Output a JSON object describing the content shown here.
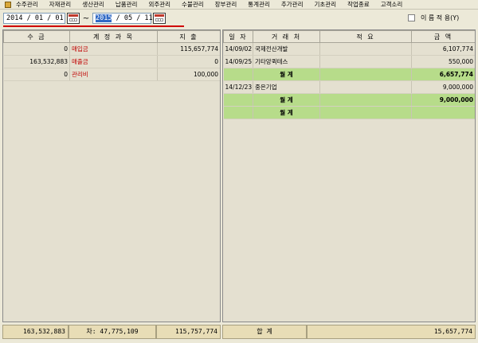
{
  "menu": [
    "수주관리",
    "자재관리",
    "생산관리",
    "납품관리",
    "외주관리",
    "수불관리",
    "장부관리",
    "통계관리",
    "추가관리",
    "기초관리",
    "작업종료",
    "고객소리"
  ],
  "date_range": {
    "start": "2014 / 01 / 01",
    "end_year": "2015",
    "end_rest": " / 05 / 11",
    "separator": "~"
  },
  "option": {
    "label": "이 름  적 용(Y)",
    "checked": false
  },
  "left_table": {
    "headers": [
      "수    금",
      "계 정 과 목",
      "지    출"
    ],
    "rows": [
      {
        "income": "0",
        "account": "매입금",
        "expense": "115,657,774"
      },
      {
        "income": "163,532,883",
        "account": "매출금",
        "expense": "0"
      },
      {
        "income": "0",
        "account": "관리비",
        "expense": "100,000"
      }
    ]
  },
  "right_table": {
    "headers": [
      "일 자",
      "거 래 처",
      "적      요",
      "금    액"
    ],
    "rows": [
      {
        "date": "14/09/02",
        "partner": "국제전산개발",
        "memo": "",
        "amount": "6,107,774",
        "total": false
      },
      {
        "date": "14/09/25",
        "partner": "기타앙퀵테스",
        "memo": "",
        "amount": "550,000",
        "total": false
      },
      {
        "date": "",
        "partner": "월    계",
        "memo": "",
        "amount": "6,657,774",
        "total": true
      },
      {
        "date": "14/12/23",
        "partner": "중은기업",
        "memo": "",
        "amount": "9,000,000",
        "total": false
      },
      {
        "date": "",
        "partner": "월    계",
        "memo": "",
        "amount": "9,000,000",
        "total": true
      },
      {
        "date": "",
        "partner": "월    계",
        "memo": "",
        "amount": "",
        "total": true
      }
    ]
  },
  "summary": {
    "income_total": "163,532,883",
    "difference": "차: 47,775,109",
    "expense_total": "115,757,774",
    "sum_label": "합      계",
    "sum_amount": "15,657,774"
  }
}
